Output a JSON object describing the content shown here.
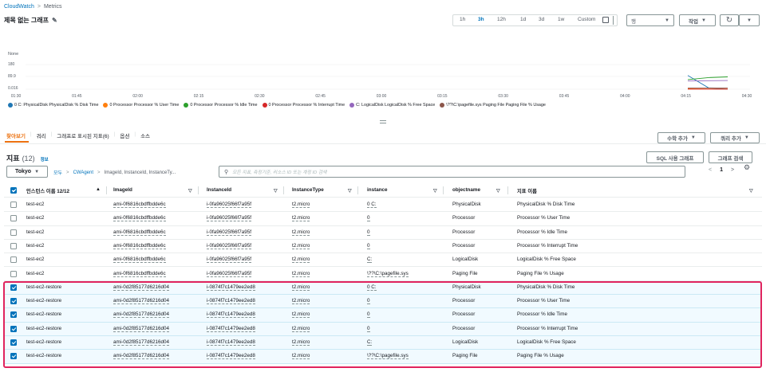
{
  "breadcrumb": {
    "root": "CloudWatch",
    "sep": ">",
    "current": "Metrics"
  },
  "graph_title": "제목 없는 그래프",
  "time_ranges": [
    "1h",
    "3h",
    "12h",
    "1d",
    "3d",
    "1w",
    "Custom"
  ],
  "active_time_range": "3h",
  "line_select": "행",
  "actions_label": "작업",
  "chart_data": {
    "type": "line",
    "y_unit_label": "None",
    "y_ticks": [
      "180",
      "89.9",
      "0.016"
    ],
    "x_ticks": [
      "01:30",
      "01:45",
      "02:00",
      "02:15",
      "02:30",
      "02:45",
      "03:00",
      "03:15",
      "03:30",
      "03:45",
      "04:00",
      "04:15",
      "04:30"
    ],
    "series": [
      {
        "name": "0 C: PhysicalDisk PhysicalDisk % Disk Time",
        "color": "#1f77b4",
        "values": [
          100,
          10,
          0.02
        ]
      },
      {
        "name": "0 Processor Processor % User Time",
        "color": "#ff7f0e",
        "values": [
          3,
          2,
          2
        ]
      },
      {
        "name": "0 Processor Processor % Idle Time",
        "color": "#2ca02c",
        "values": [
          70,
          85,
          90
        ]
      },
      {
        "name": "0 Processor Processor % Interrupt Time",
        "color": "#d62728",
        "values": [
          0.5,
          0.5,
          0.5
        ]
      },
      {
        "name": "C: LogicalDisk LogicalDisk % Free Space",
        "color": "#9467bd",
        "values": [
          60,
          62,
          63
        ]
      },
      {
        "name": "\\??\\C:\\pagefile.sys Paging File Paging File % Usage",
        "color": "#8c564b",
        "values": [
          8,
          8,
          8
        ]
      }
    ]
  },
  "tabs": [
    "찾아보기",
    "쿼리",
    "그래프로 표시된 지표(6)",
    "옵션",
    "소스"
  ],
  "active_tab": "찾아보기",
  "add_math_label": "수학 추가",
  "add_query_label": "쿼리 추가",
  "metrics_title": "지표",
  "metrics_count": "(12)",
  "info_label": "정보",
  "sql_graph_label": "SQL 사용 그래프",
  "graph_search_label": "그래프 검색",
  "region": "Tokyo",
  "filter_crumbs": {
    "all": "모두",
    "namespace": "CWAgent",
    "dims": "ImageId, InstanceId, InstanceTy..."
  },
  "search_placeholder": "모든 지표, 측정기준, 리소스 ID 또는 계정 ID 검색",
  "page_number": "1",
  "columns": [
    "인스턴스 이름 12/12",
    "ImageId",
    "InstanceId",
    "InstanceType",
    "instance",
    "objectname",
    "지표 이름"
  ],
  "rows": [
    {
      "checked": false,
      "name": "test-ec2",
      "image": "ami-0f6816cbdffbdde6c",
      "inst": "i-0fa96025f66f7a95f",
      "type": "t2.micro",
      "instance": "0 C:",
      "obj": "PhysicalDisk",
      "metric": "PhysicalDisk % Disk Time"
    },
    {
      "checked": false,
      "name": "test-ec2",
      "image": "ami-0f6816cbdffbdde6c",
      "inst": "i-0fa96025f66f7a95f",
      "type": "t2.micro",
      "instance": "0",
      "obj": "Processor",
      "metric": "Processor % User Time"
    },
    {
      "checked": false,
      "name": "test-ec2",
      "image": "ami-0f6816cbdffbdde6c",
      "inst": "i-0fa96025f66f7a95f",
      "type": "t2.micro",
      "instance": "0",
      "obj": "Processor",
      "metric": "Processor % Idle Time"
    },
    {
      "checked": false,
      "name": "test-ec2",
      "image": "ami-0f6816cbdffbdde6c",
      "inst": "i-0fa96025f66f7a95f",
      "type": "t2.micro",
      "instance": "0",
      "obj": "Processor",
      "metric": "Processor % Interrupt Time"
    },
    {
      "checked": false,
      "name": "test-ec2",
      "image": "ami-0f6816cbdffbdde6c",
      "inst": "i-0fa96025f66f7a95f",
      "type": "t2.micro",
      "instance": "C:",
      "obj": "LogicalDisk",
      "metric": "LogicalDisk % Free Space"
    },
    {
      "checked": false,
      "name": "test-ec2",
      "image": "ami-0f6816cbdffbdde6c",
      "inst": "i-0fa96025f66f7a95f",
      "type": "t2.micro",
      "instance": "\\??\\C:\\pagefile.sys",
      "obj": "Paging File",
      "metric": "Paging File % Usage"
    },
    {
      "checked": true,
      "name": "test-ec2-restore",
      "image": "ami-0d2f85177d6216d04",
      "inst": "i-0874f7c1479ee2ed8",
      "type": "t2.micro",
      "instance": "0 C:",
      "obj": "PhysicalDisk",
      "metric": "PhysicalDisk % Disk Time"
    },
    {
      "checked": true,
      "name": "test-ec2-restore",
      "image": "ami-0d2f85177d6216d04",
      "inst": "i-0874f7c1479ee2ed8",
      "type": "t2.micro",
      "instance": "0",
      "obj": "Processor",
      "metric": "Processor % User Time"
    },
    {
      "checked": true,
      "name": "test-ec2-restore",
      "image": "ami-0d2f85177d6216d04",
      "inst": "i-0874f7c1479ee2ed8",
      "type": "t2.micro",
      "instance": "0",
      "obj": "Processor",
      "metric": "Processor % Idle Time"
    },
    {
      "checked": true,
      "name": "test-ec2-restore",
      "image": "ami-0d2f85177d6216d04",
      "inst": "i-0874f7c1479ee2ed8",
      "type": "t2.micro",
      "instance": "0",
      "obj": "Processor",
      "metric": "Processor % Interrupt Time"
    },
    {
      "checked": true,
      "name": "test-ec2-restore",
      "image": "ami-0d2f85177d6216d04",
      "inst": "i-0874f7c1479ee2ed8",
      "type": "t2.micro",
      "instance": "C:",
      "obj": "LogicalDisk",
      "metric": "LogicalDisk % Free Space"
    },
    {
      "checked": true,
      "name": "test-ec2-restore",
      "image": "ami-0d2f85177d6216d04",
      "inst": "i-0874f7c1479ee2ed8",
      "type": "t2.micro",
      "instance": "\\??\\C:\\pagefile.sys",
      "obj": "Paging File",
      "metric": "Paging File % Usage"
    }
  ],
  "highlight_color": "#e0245e"
}
